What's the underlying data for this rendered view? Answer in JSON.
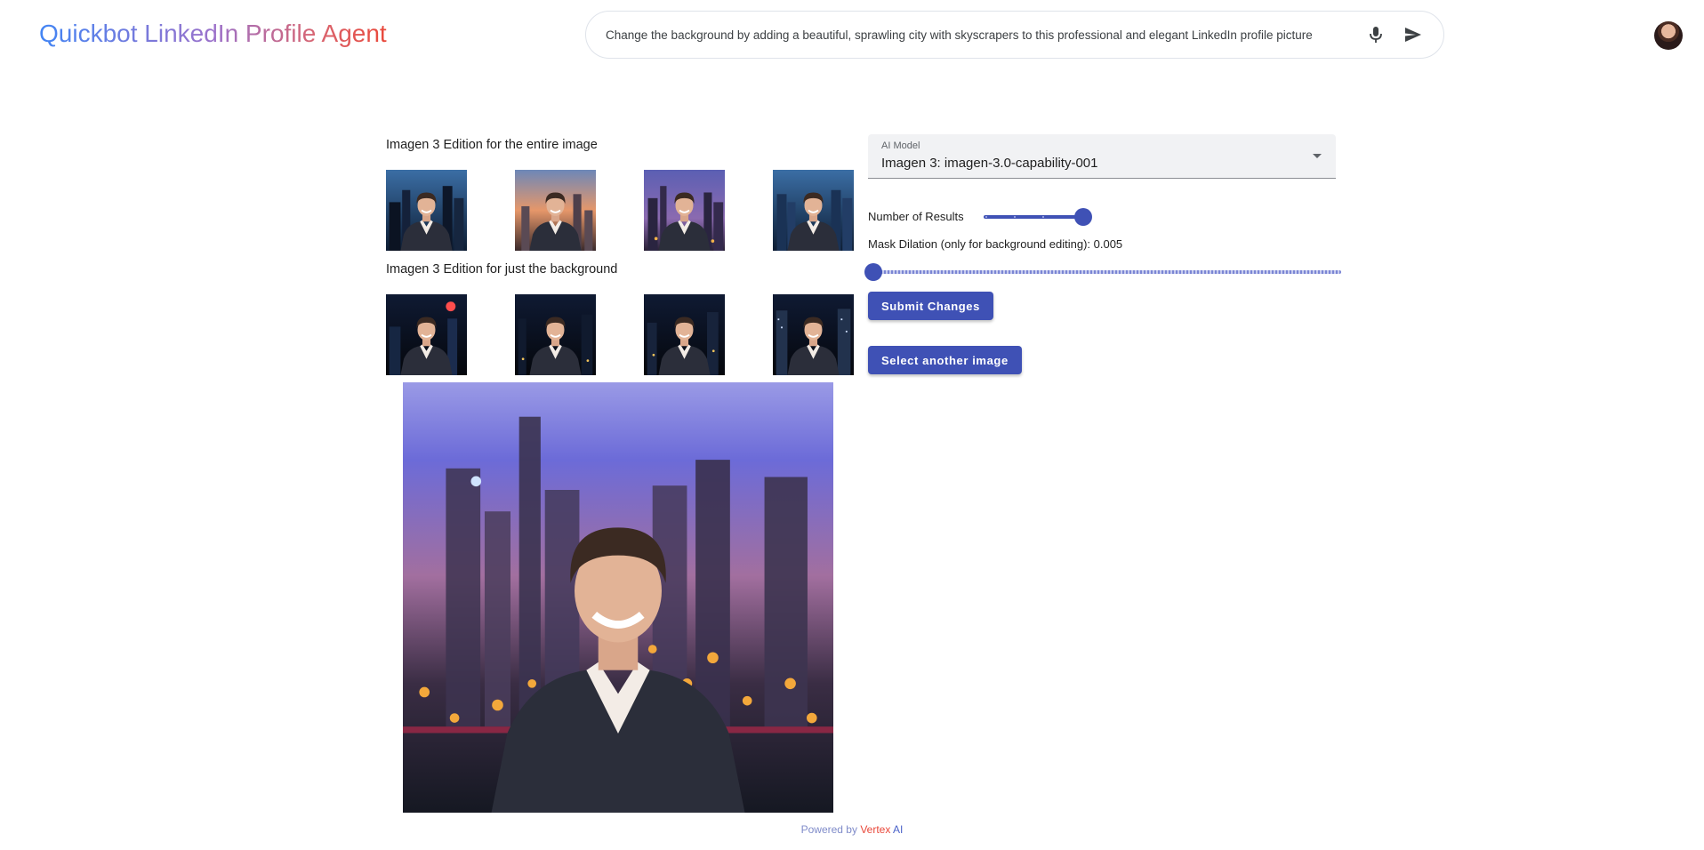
{
  "header": {
    "title": "Quickbot LinkedIn Profile Agent",
    "prompt_value": "Change the background by adding a beautiful, sprawling city with skyscrapers to this professional and elegant LinkedIn profile picture",
    "mic_icon": "microphone-icon",
    "send_icon": "send-icon",
    "avatar": "user-avatar"
  },
  "results": {
    "entire_title": "Imagen 3 Edition for the entire image",
    "entire_images": 4,
    "background_title": "Imagen 3 Edition for just the background",
    "background_images": 4
  },
  "controls": {
    "model_label": "AI Model",
    "model_value": "Imagen 3: imagen-3.0-capability-001",
    "results_label": "Number of Results",
    "results_slider_fraction": 1.0,
    "dilation_label": "Mask Dilation (only for background editing): 0.005",
    "dilation_slider_fraction": 0.0,
    "submit_label": "Submit Changes",
    "select_label": "Select another image"
  },
  "footer": {
    "prefix": "Powered by",
    "brand_v": "Vertex",
    "brand_ai": "AI"
  },
  "colors": {
    "accent": "#3f51b5",
    "title_gradient": [
      "#4285f4",
      "#9b72cb",
      "#d96570",
      "#e9483a"
    ]
  }
}
